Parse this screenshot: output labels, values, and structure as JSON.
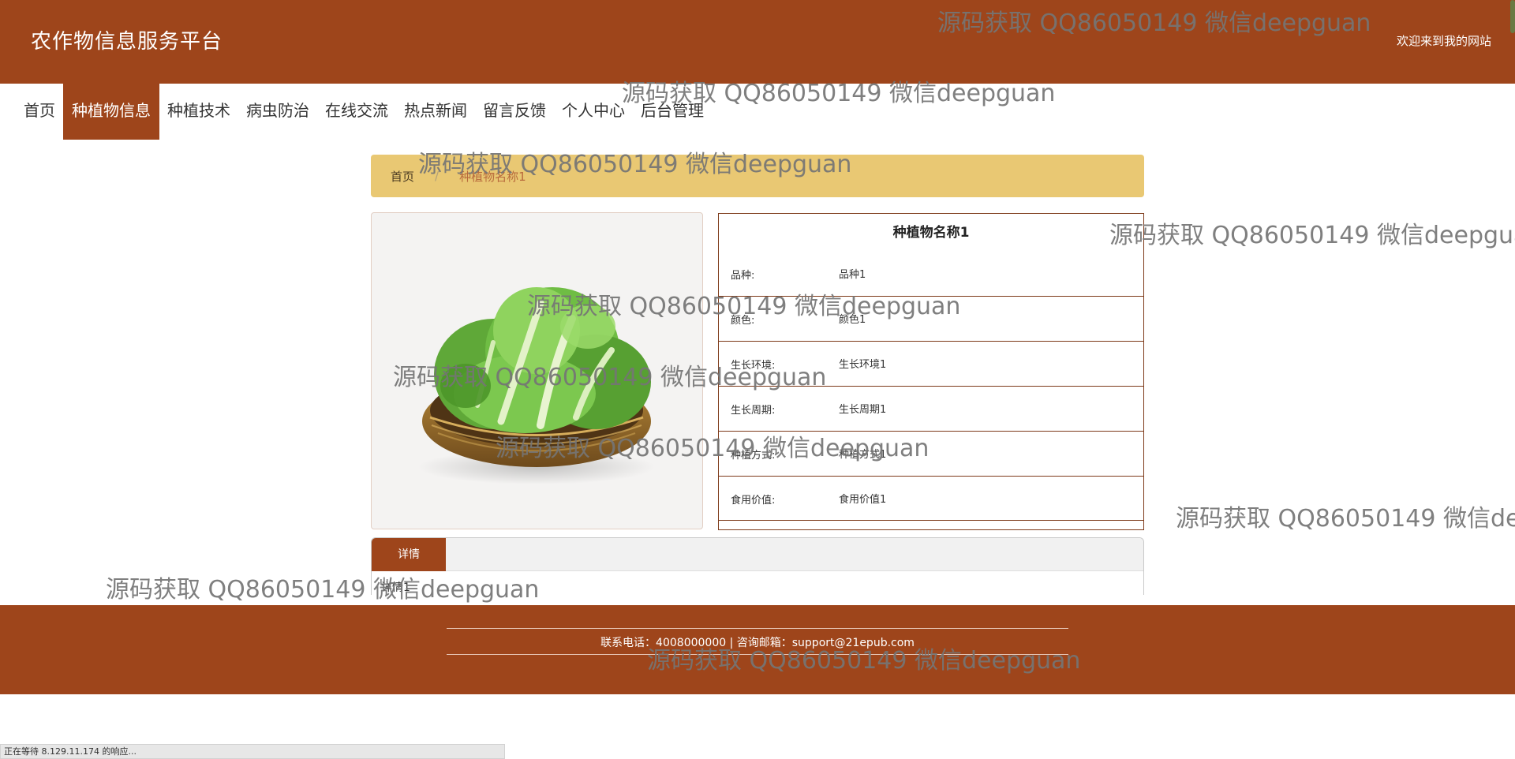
{
  "header": {
    "site_title": "农作物信息服务平台",
    "welcome": "欢迎来到我的网站"
  },
  "nav": [
    {
      "label": "首页"
    },
    {
      "label": "种植物信息"
    },
    {
      "label": "种植技术"
    },
    {
      "label": "病虫防治"
    },
    {
      "label": "在线交流"
    },
    {
      "label": "热点新闻"
    },
    {
      "label": "留言反馈"
    },
    {
      "label": "个人中心"
    },
    {
      "label": "后台管理"
    }
  ],
  "breadcrumb": {
    "home": "首页",
    "separator": "/",
    "current": "种植物名称1"
  },
  "product": {
    "name": "种植物名称1",
    "fields": [
      {
        "label": "品种:",
        "value": "品种1"
      },
      {
        "label": "颜色:",
        "value": "颜色1"
      },
      {
        "label": "生长环境:",
        "value": "生长环境1"
      },
      {
        "label": "生长周期:",
        "value": "生长周期1"
      },
      {
        "label": "种植方式:",
        "value": "种植方式1"
      },
      {
        "label": "食用价值:",
        "value": "食用价值1"
      }
    ]
  },
  "tabs": {
    "detail_label": "详情",
    "content": "详情1"
  },
  "footer": {
    "contact": "联系电话：4008000000 | 咨询邮箱：support@21epub.com"
  },
  "status_bar": {
    "text": "正在等待 8.129.11.174 的响应..."
  },
  "watermark": {
    "text": "源码获取 QQ86050149 微信deepguan"
  },
  "colors": {
    "primary": "#9e451b",
    "breadcrumb_bg": "#e9c873",
    "crumb_current": "#b86a3c"
  }
}
